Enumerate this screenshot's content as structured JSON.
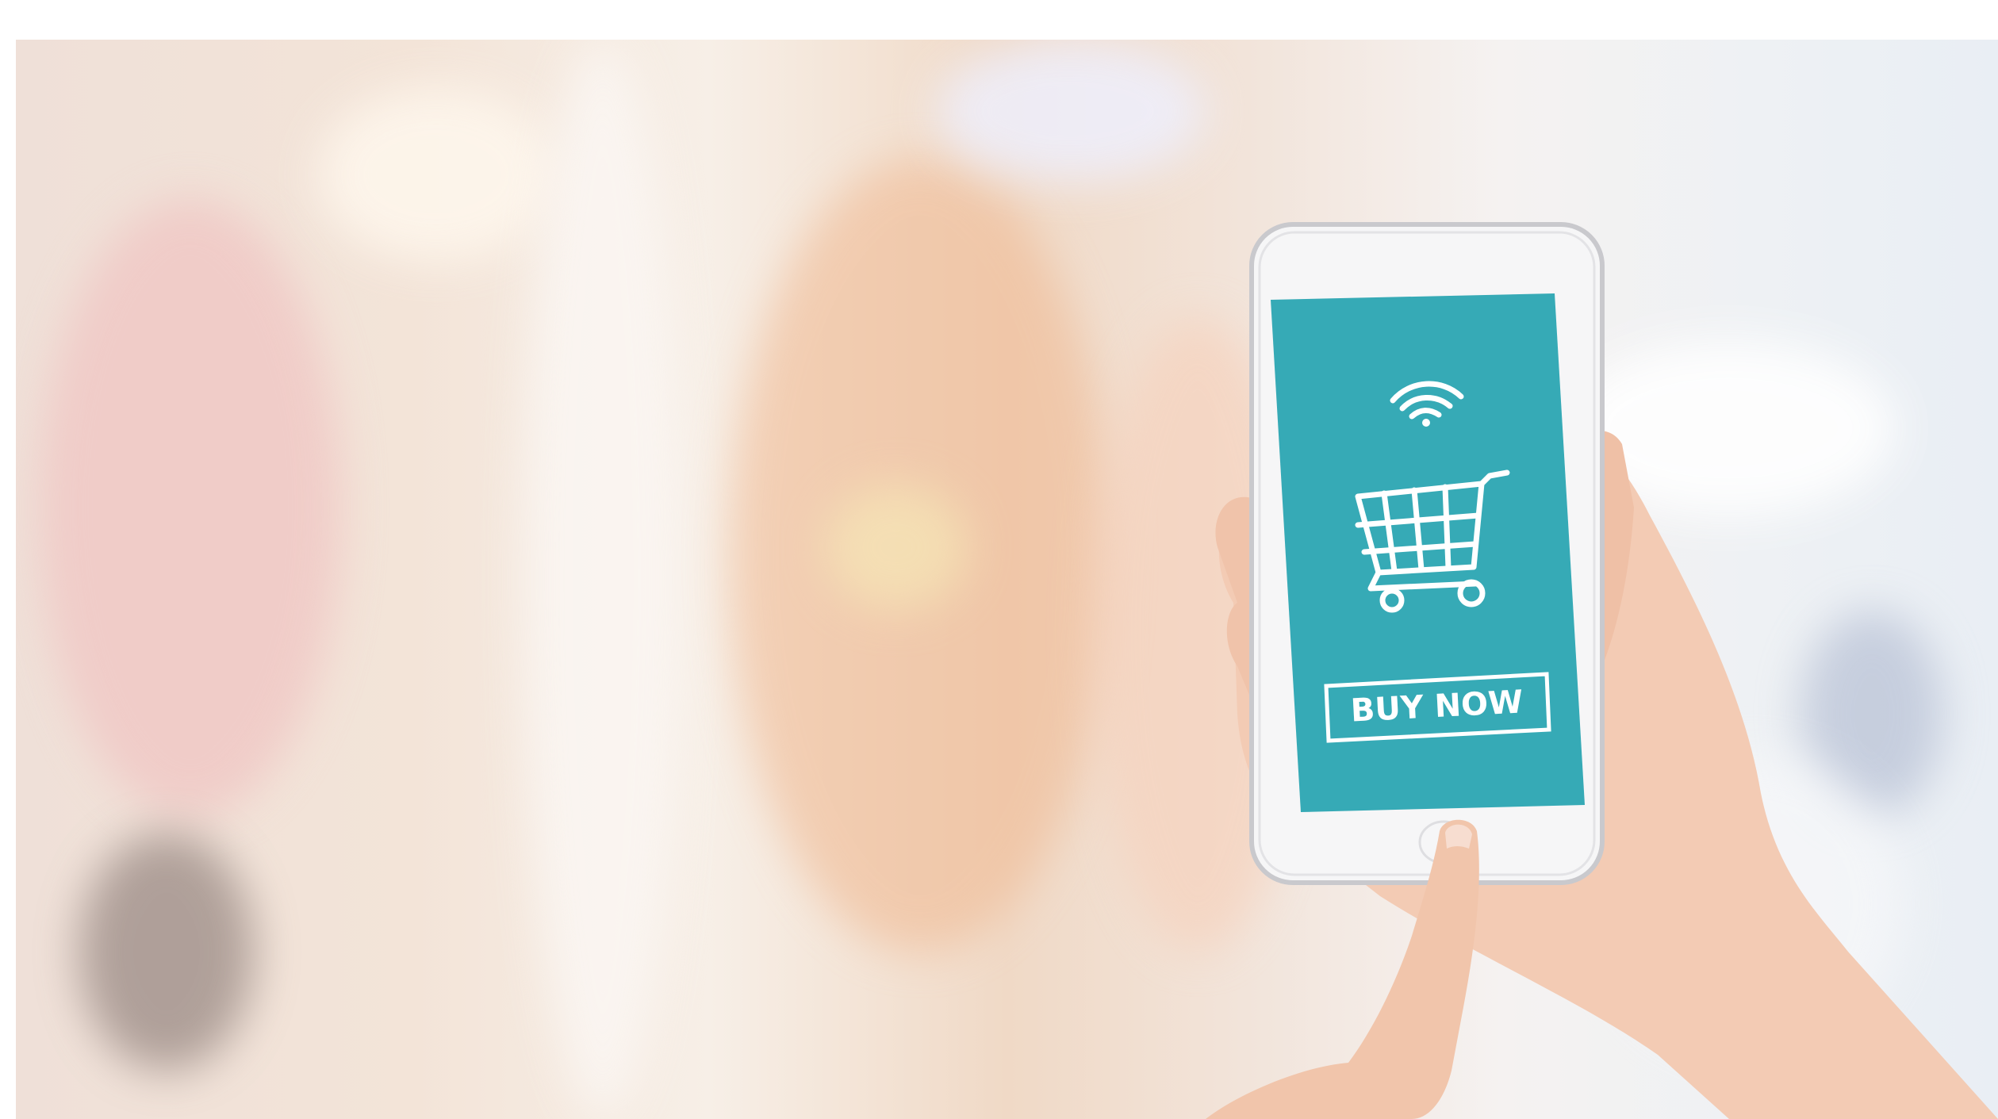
{
  "screen": {
    "button_label": "BUY NOW"
  },
  "icons": {
    "signal": "wifi-signal-icon",
    "cart": "shopping-cart-icon"
  },
  "colors": {
    "screen": "#36aab6",
    "phone_body": "#f6f6f7",
    "skin": "#f3cbb4",
    "background_warm": "#f1dccd",
    "background_cool": "#e9eef4"
  }
}
